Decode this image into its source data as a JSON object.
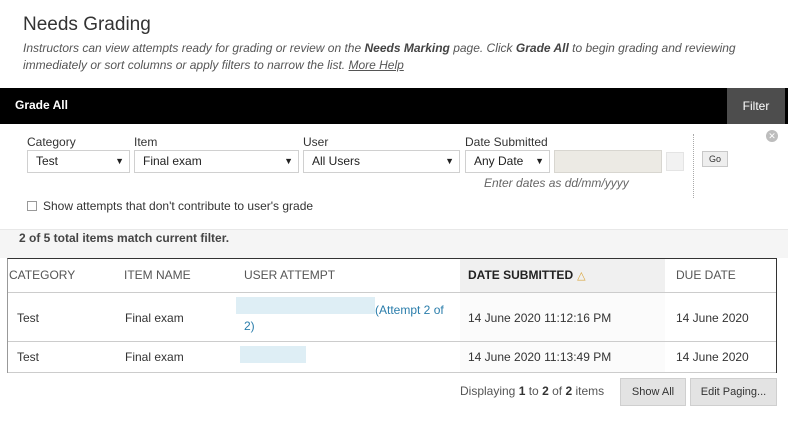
{
  "page": {
    "title": "Needs Grading",
    "instructions_part1": "Instructors can view attempts ready for grading or review on the ",
    "instructions_bold1": "Needs Marking",
    "instructions_part2": " page. Click ",
    "instructions_bold2": "Grade All",
    "instructions_part3": " to begin grading and reviewing immediately or sort columns or apply filters to narrow the list. ",
    "help_link": "More Help"
  },
  "action_bar": {
    "grade_all": "Grade All",
    "filter": "Filter"
  },
  "filters": {
    "category_label": "Category",
    "category_value": "Test",
    "item_label": "Item",
    "item_value": "Final exam",
    "user_label": "User",
    "user_value": "All Users",
    "date_label": "Date Submitted",
    "date_value": "Any Date",
    "date_hint": "Enter dates as dd/mm/yyyy",
    "go": "Go",
    "checkbox_label": "Show attempts that don't contribute to user's grade"
  },
  "results": {
    "count_text": "2 of 5 total items match current filter."
  },
  "table": {
    "headers": {
      "category": "CATEGORY",
      "item_name": "ITEM NAME",
      "user_attempt": "USER ATTEMPT",
      "date_submitted": "DATE SUBMITTED",
      "due_date": "DUE DATE"
    },
    "rows": [
      {
        "category": "Test",
        "item_name": "Final exam",
        "attempt_line1": "(Attempt 2 of",
        "attempt_line2": "2)",
        "date_submitted": "14 June 2020 11:12:16 PM",
        "due_date": "14 June 2020"
      },
      {
        "category": "Test",
        "item_name": "Final exam",
        "date_submitted": "14 June 2020 11:13:49 PM",
        "due_date": "14 June 2020"
      }
    ]
  },
  "paging": {
    "prefix": "Displaying ",
    "from": "1",
    "mid": " to ",
    "to": "2",
    "of": " of ",
    "total": "2",
    "suffix": " items",
    "show_all": "Show All",
    "edit_paging": "Edit Paging..."
  },
  "icons": {
    "sort": "sort-ascending-icon",
    "close": "close-circle-icon",
    "caret": "chevron-down-icon"
  }
}
